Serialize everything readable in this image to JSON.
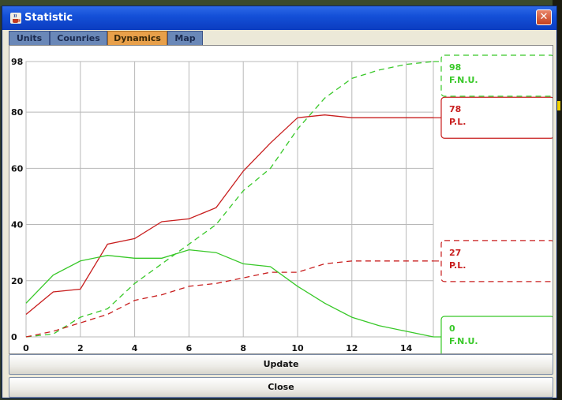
{
  "window": {
    "title": "Statistic",
    "close_glyph": "✕"
  },
  "tabs": [
    {
      "label": "Units",
      "active": false
    },
    {
      "label": "Counries",
      "active": false
    },
    {
      "label": "Dynamics",
      "active": true
    },
    {
      "label": "Map",
      "active": false
    }
  ],
  "buttons": {
    "update": "Update",
    "close": "Close"
  },
  "chart_data": {
    "type": "line",
    "xlim": [
      0,
      15
    ],
    "ylim": [
      0,
      98
    ],
    "x_ticks": [
      0,
      2,
      4,
      6,
      8,
      10,
      12,
      14
    ],
    "y_ticks": [
      0,
      20,
      40,
      60,
      80,
      98
    ],
    "grid": true,
    "series": [
      {
        "color": "#c81e1e",
        "style": "solid",
        "x": [
          0,
          1,
          2,
          3,
          4,
          5,
          6,
          7,
          8,
          9,
          10,
          11,
          12,
          13,
          14,
          15
        ],
        "values": [
          8,
          16,
          17,
          33,
          35,
          41,
          42,
          46,
          59,
          69,
          78,
          79,
          78,
          78,
          78,
          78
        ],
        "label": {
          "value": "78",
          "name": "P.L."
        }
      },
      {
        "color": "#38c828",
        "style": "dashed",
        "x": [
          0,
          1,
          2,
          3,
          4,
          5,
          6,
          7,
          8,
          9,
          10,
          11,
          12,
          13,
          14,
          15
        ],
        "values": [
          0,
          1,
          7,
          10,
          19,
          26,
          33,
          40,
          52,
          60,
          74,
          85,
          92,
          95,
          97,
          98
        ],
        "label": {
          "value": "98",
          "name": "F.N.U."
        }
      },
      {
        "color": "#c81e1e",
        "style": "dashed",
        "x": [
          0,
          1,
          2,
          3,
          4,
          5,
          6,
          7,
          8,
          9,
          10,
          11,
          12,
          13,
          14,
          15
        ],
        "values": [
          0,
          2,
          5,
          8,
          13,
          15,
          18,
          19,
          21,
          23,
          23,
          26,
          27,
          27,
          27,
          27
        ],
        "label": {
          "value": "27",
          "name": "P.L."
        }
      },
      {
        "color": "#38c828",
        "style": "solid",
        "x": [
          0,
          1,
          2,
          3,
          4,
          5,
          6,
          7,
          8,
          9,
          10,
          11,
          12,
          13,
          14,
          15
        ],
        "values": [
          12,
          22,
          27,
          29,
          28,
          28,
          31,
          30,
          26,
          25,
          18,
          12,
          7,
          4,
          2,
          0
        ],
        "label": {
          "value": "0",
          "name": "F.N.U."
        }
      }
    ]
  }
}
